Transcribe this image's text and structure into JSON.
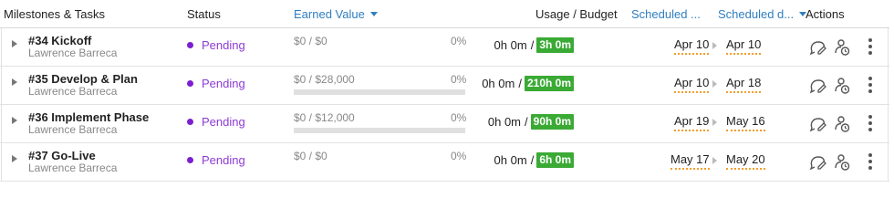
{
  "header": {
    "tasks": "Milestones & Tasks",
    "status": "Status",
    "earned_value": "Earned Value",
    "usage_budget": "Usage / Budget",
    "scheduled_start": "Scheduled ...",
    "scheduled_due": "Scheduled d...",
    "actions": "Actions"
  },
  "rows": [
    {
      "title": "#34 Kickoff",
      "owner": "Lawrence Barreca",
      "status": "Pending",
      "earned_value": "$0 / $0",
      "ev_pct": "0%",
      "show_bar": false,
      "usage": "0h 0m",
      "separator": "/",
      "budget": "3h 0m",
      "start": "Apr 10",
      "due": "Apr 10"
    },
    {
      "title": "#35 Develop & Plan",
      "owner": "Lawrence Barreca",
      "status": "Pending",
      "earned_value": "$0 / $28,000",
      "ev_pct": "0%",
      "show_bar": true,
      "usage": "0h 0m",
      "separator": "/",
      "budget": "210h 0m",
      "start": "Apr 10",
      "due": "Apr 18"
    },
    {
      "title": "#36 Implement Phase",
      "owner": "Lawrence Barreca",
      "status": "Pending",
      "earned_value": "$0 / $12,000",
      "ev_pct": "0%",
      "show_bar": true,
      "usage": "0h 0m",
      "separator": "/",
      "budget": "90h 0m",
      "start": "Apr 19",
      "due": "May 16"
    },
    {
      "title": "#37 Go-Live",
      "owner": "Lawrence Barreca",
      "status": "Pending",
      "earned_value": "$0 / $0",
      "ev_pct": "0%",
      "show_bar": false,
      "usage": "0h 0m",
      "separator": "/",
      "budget": "6h 0m",
      "start": "May 17",
      "due": "May 20"
    }
  ],
  "colors": {
    "status_pending": "#8d3bd6",
    "budget_badge": "#3aaa35",
    "header_link": "#2f7fc1",
    "date_underline": "#f29e2a"
  },
  "icons": [
    "expand-arrow-icon",
    "comment-edit-icon",
    "assign-user-clock-icon",
    "more-options-icon",
    "sort-caret-icon"
  ]
}
